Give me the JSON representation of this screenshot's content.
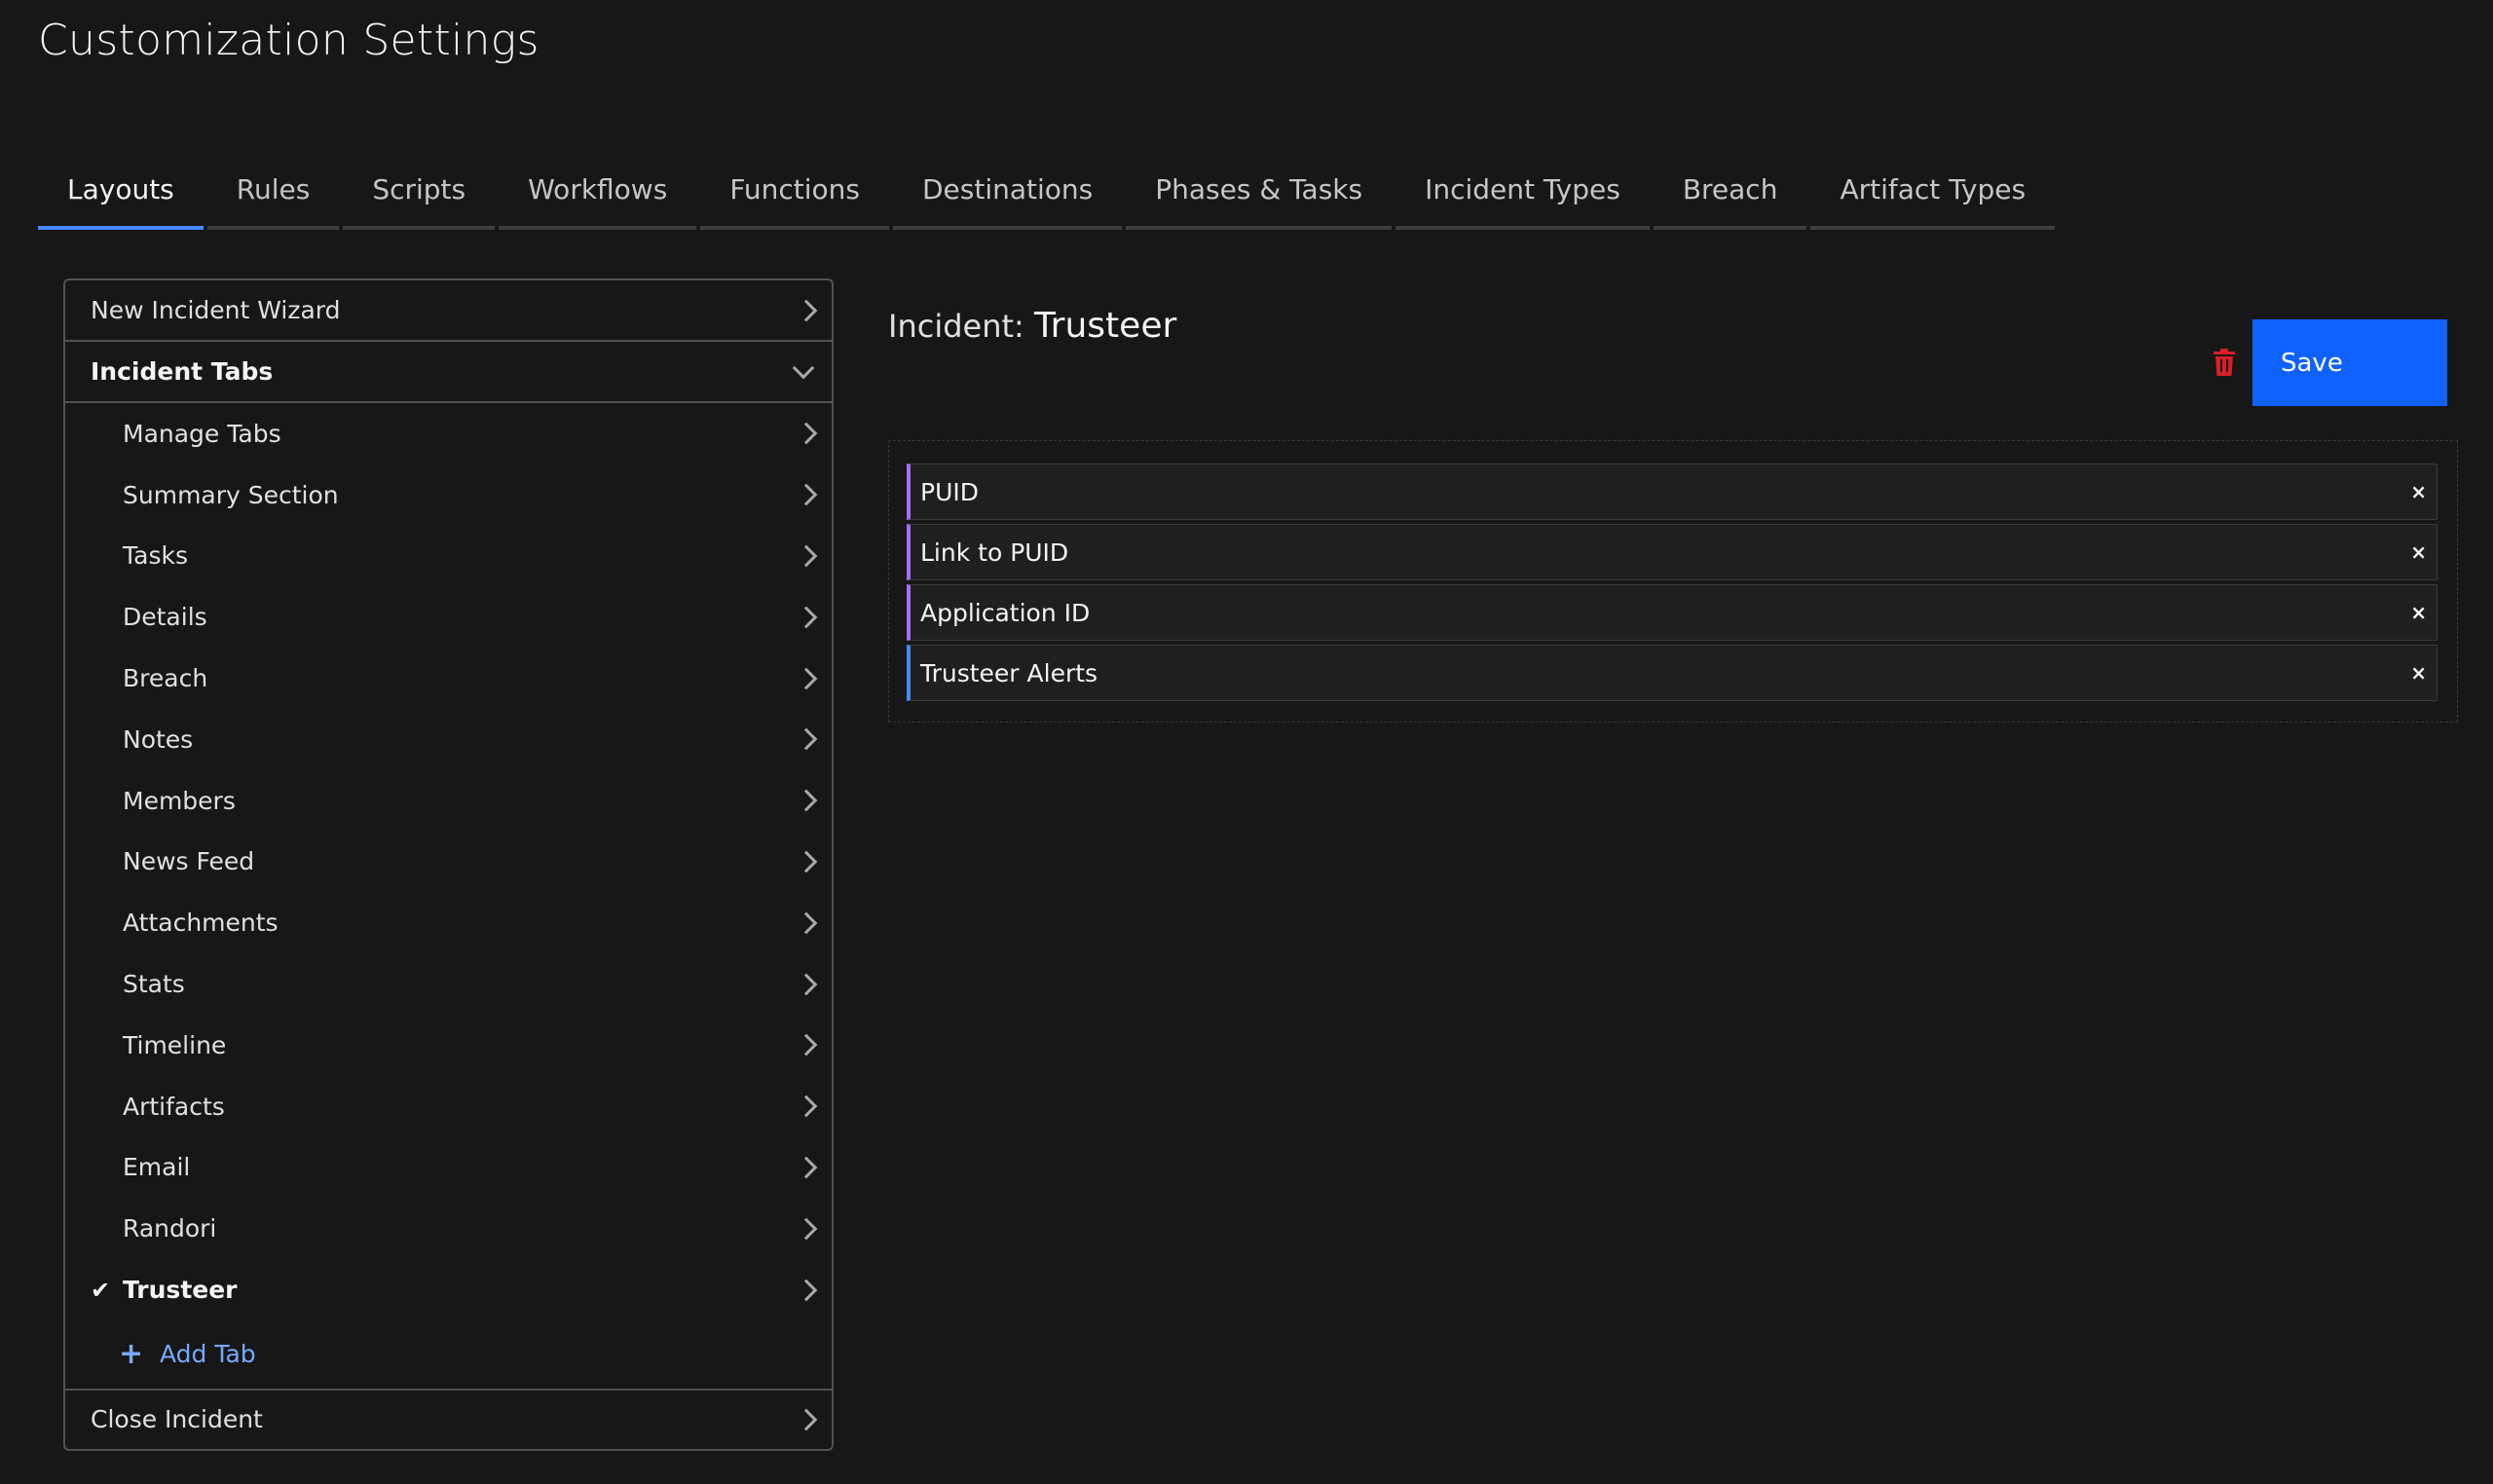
{
  "page": {
    "title": "Customization Settings"
  },
  "tabs": [
    {
      "label": "Layouts",
      "active": true
    },
    {
      "label": "Rules"
    },
    {
      "label": "Scripts"
    },
    {
      "label": "Workflows"
    },
    {
      "label": "Functions"
    },
    {
      "label": "Destinations"
    },
    {
      "label": "Phases & Tasks"
    },
    {
      "label": "Incident Types"
    },
    {
      "label": "Breach"
    },
    {
      "label": "Artifact Types"
    }
  ],
  "sidebar": {
    "top_item": "New Incident Wizard",
    "section_label": "Incident Tabs",
    "items": [
      "Manage Tabs",
      "Summary Section",
      "Tasks",
      "Details",
      "Breach",
      "Notes",
      "Members",
      "News Feed",
      "Attachments",
      "Stats",
      "Timeline",
      "Artifacts",
      "Email",
      "Randori",
      "Trusteer"
    ],
    "selected_item": "Trusteer",
    "add_tab_label": "Add Tab",
    "bottom_item": "Close Incident"
  },
  "main": {
    "heading_prefix": "Incident:",
    "heading_name": "Trusteer",
    "save_label": "Save",
    "fields": [
      {
        "label": "PUID"
      },
      {
        "label": "Link to PUID"
      },
      {
        "label": "Application ID"
      },
      {
        "label": "Trusteer Alerts"
      }
    ],
    "remove_symbol": "×"
  },
  "colors": {
    "background": "#171717",
    "accent": "#0f62fe",
    "tab_active_underline": "#4589ff",
    "field_border_purple": "#a56eff",
    "field_border_blue": "#4589ff",
    "link": "#78a9ff",
    "trash": "#da1e28"
  },
  "icons": {
    "chevron": "chevron-right-icon",
    "section_toggle": "chevron-down-icon",
    "selected": "checkmark-icon",
    "add": "plus-icon",
    "delete": "trash-icon",
    "remove": "close-icon"
  }
}
